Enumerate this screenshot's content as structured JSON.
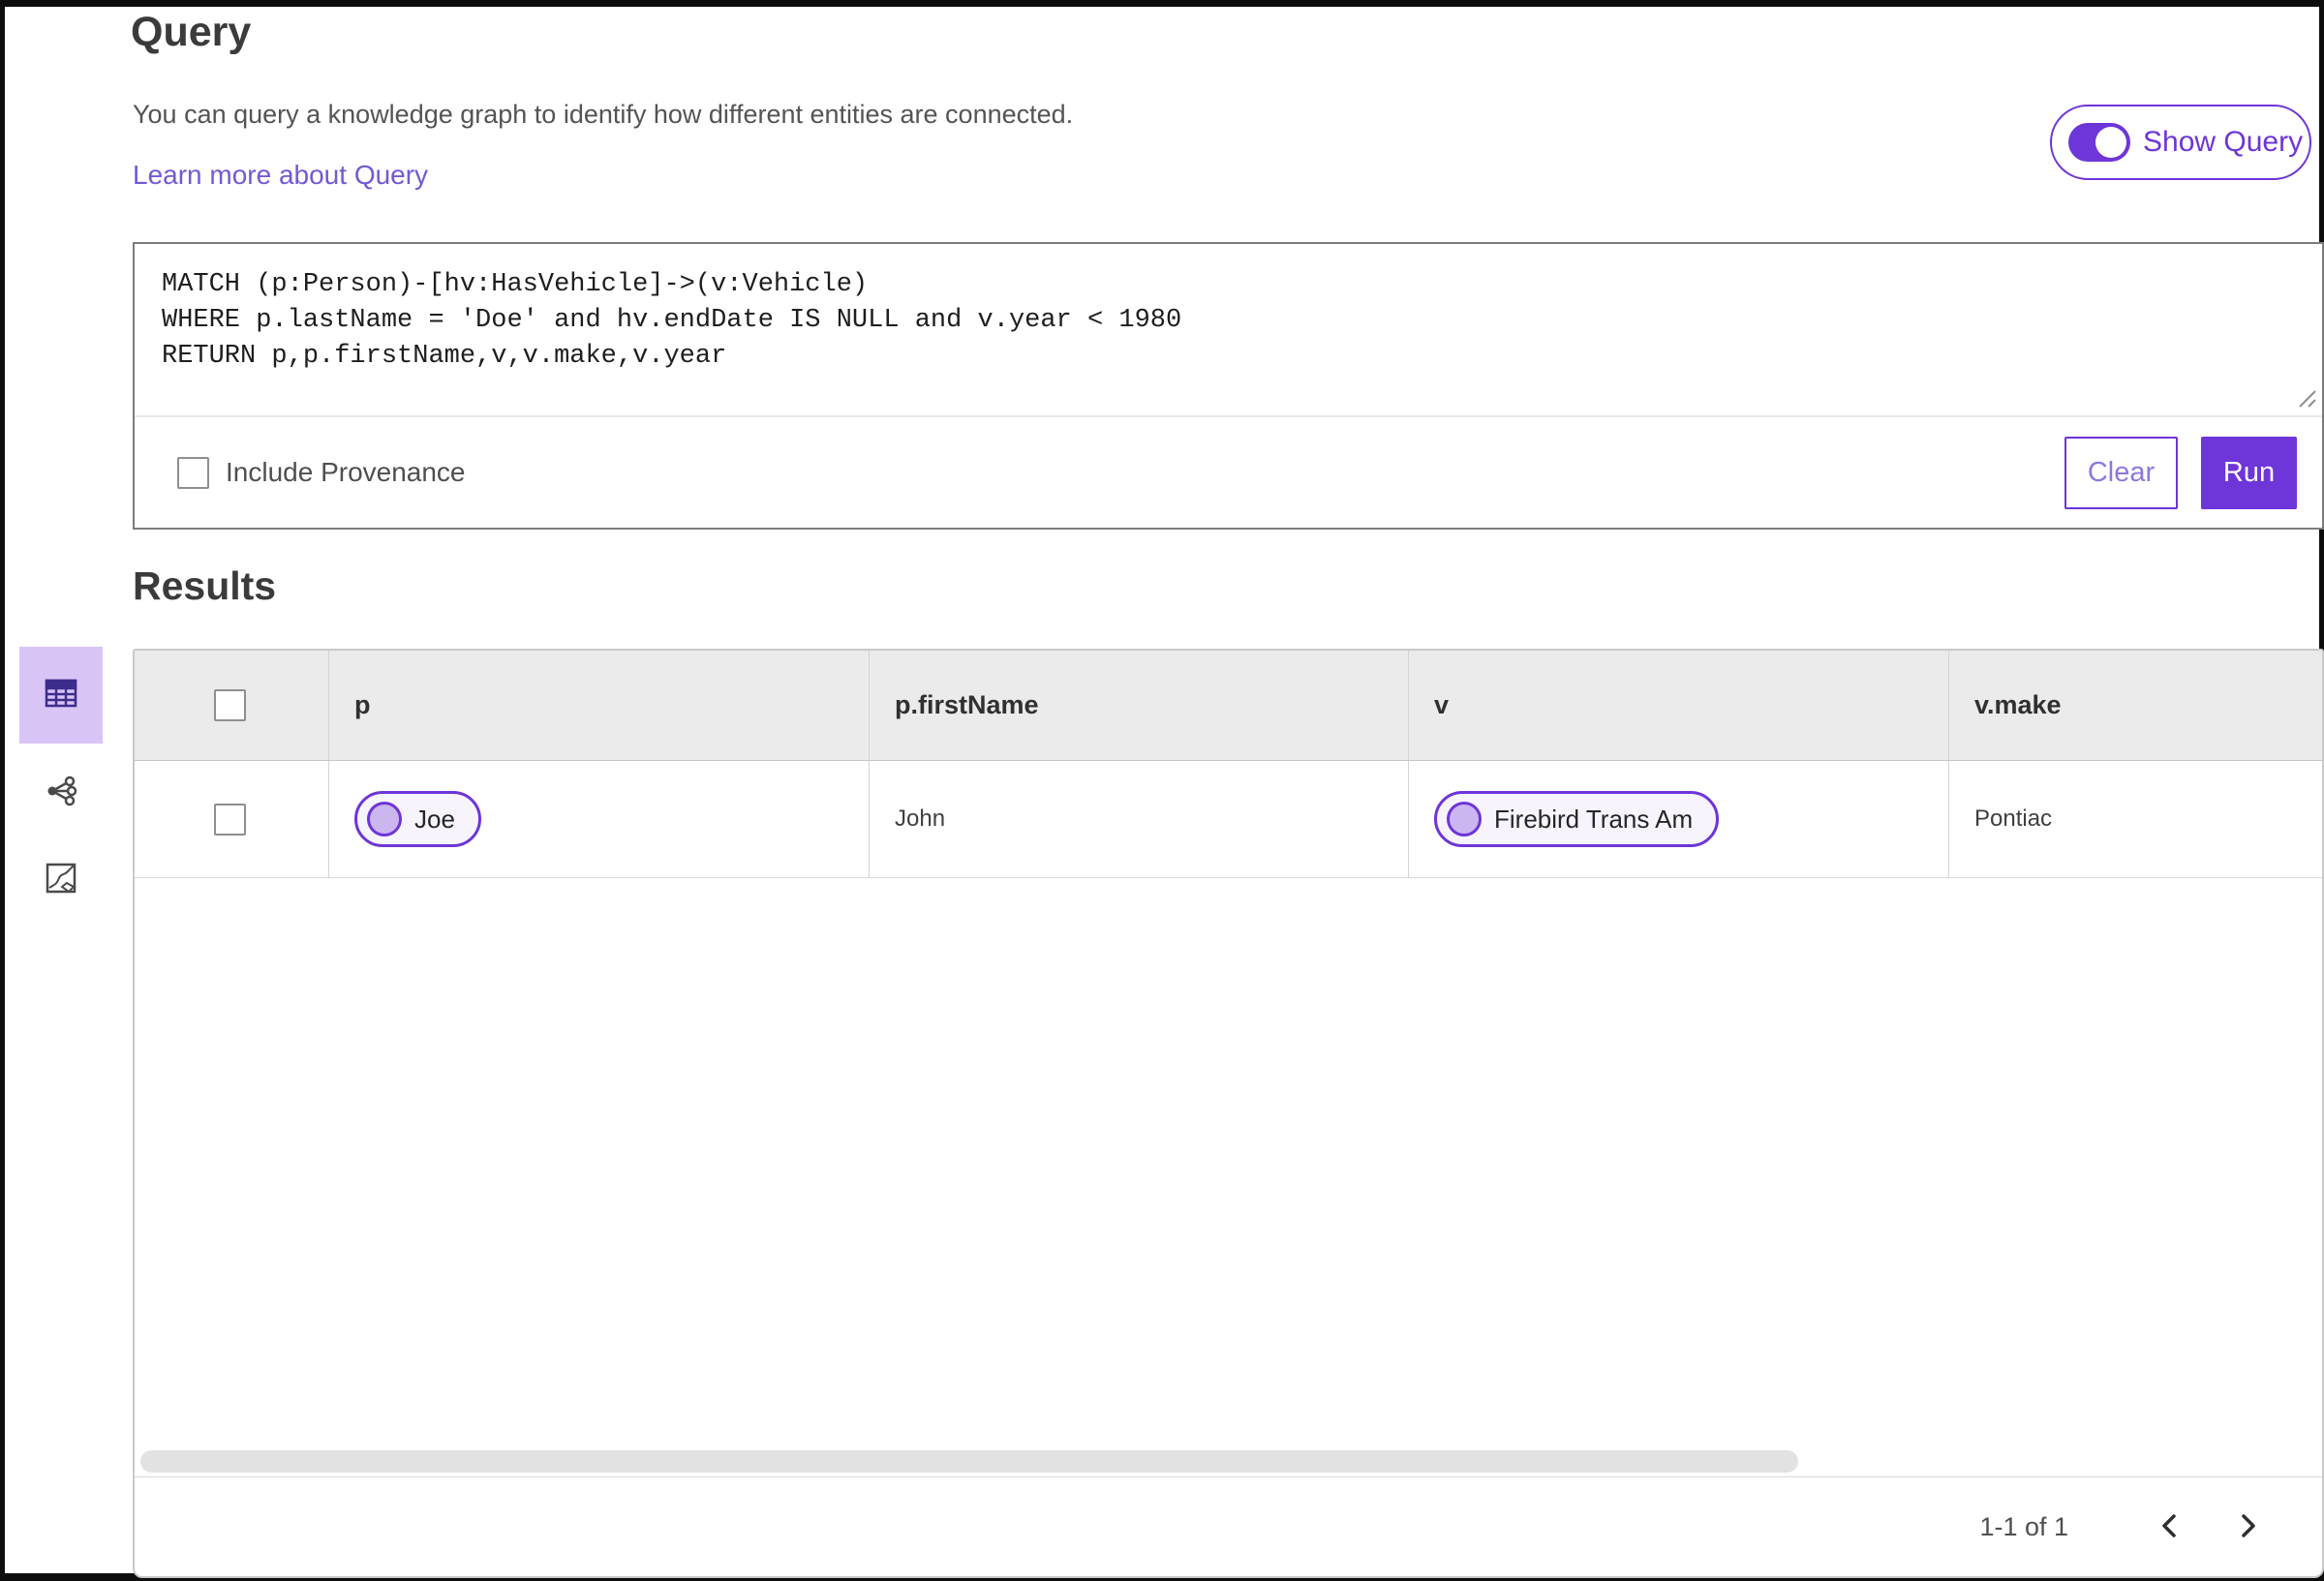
{
  "header": {
    "title": "Query",
    "description": "You can query a knowledge graph to identify how different entities are connected.",
    "learn_more_link": "Learn more about Query",
    "show_query_toggle": {
      "label": "Show Query",
      "state": "on"
    }
  },
  "query_editor": {
    "code": "MATCH (p:Person)-[hv:HasVehicle]->(v:Vehicle)\nWHERE p.lastName = 'Doe' and hv.endDate IS NULL and v.year < 1980\nRETURN p,p.firstName,v,v.make,v.year",
    "include_provenance": {
      "label": "Include Provenance",
      "checked": false
    },
    "buttons": {
      "clear": "Clear",
      "run": "Run"
    }
  },
  "results": {
    "title": "Results",
    "view_switcher": {
      "items": [
        {
          "name": "table-view",
          "selected": true
        },
        {
          "name": "graph-view",
          "selected": false
        },
        {
          "name": "map-view",
          "selected": false
        }
      ]
    },
    "table": {
      "columns": [
        "p",
        "p.firstName",
        "v",
        "v.make"
      ],
      "rows": [
        {
          "p": {
            "kind": "entity-chip",
            "label": "Joe"
          },
          "p_firstName": "John",
          "v": {
            "kind": "entity-chip",
            "label": "Firebird Trans Am"
          },
          "v_make": "Pontiac"
        }
      ]
    },
    "pagination": {
      "range_label": "1-1 of 1"
    }
  },
  "colors": {
    "accent": "#6e35d9",
    "accent_selected_bg": "#d9c4f6",
    "chip_bg": "#f7f4fe",
    "chip_circle": "#cbb6f0",
    "table_header_bg": "#ebebeb",
    "link": "#7259d6"
  }
}
